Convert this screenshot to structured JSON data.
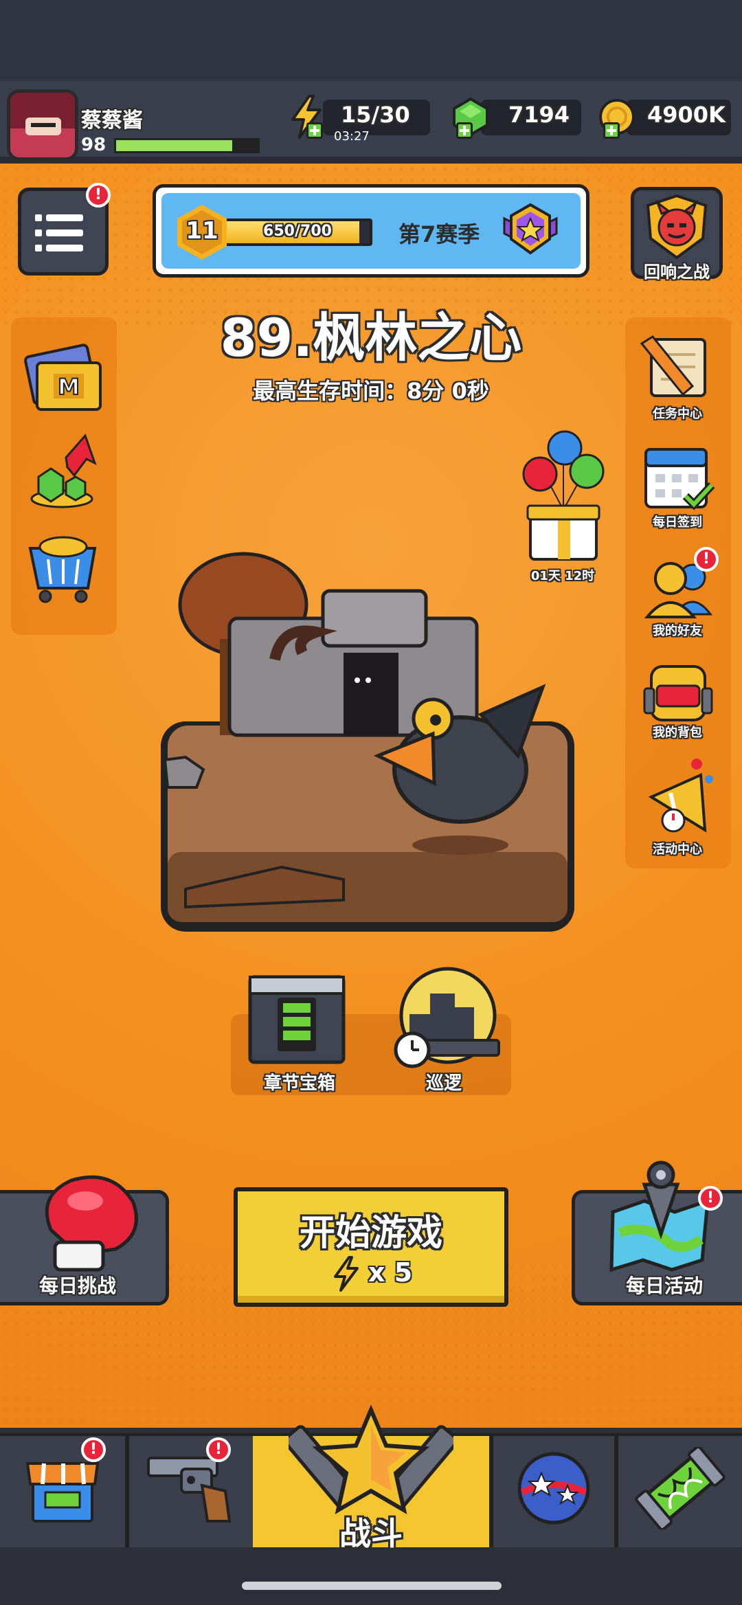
{
  "player": {
    "name": "蔡蔡酱",
    "level": "98",
    "xp_fraction": 0.82
  },
  "resources": {
    "energy": "15/30",
    "energy_timer": "03:27",
    "gems": "7194",
    "coins": "4900K"
  },
  "season": {
    "level": "11",
    "progress_text": "650/700",
    "progress_fraction": 0.9286,
    "name": "第7赛季"
  },
  "echo_battle": {
    "label": "回响之战"
  },
  "stage": {
    "title": "89.枫林之心",
    "best_time": "最高生存时间：8分 0秒"
  },
  "right_menu": {
    "tasks": "任务中心",
    "daily_signin": "每日签到",
    "friends": "我的好友",
    "backpack": "我的背包",
    "events": "活动中心"
  },
  "gift_timer": "01天 12时",
  "chapter": {
    "chest_label": "章节宝箱",
    "patrol_label": "巡逻"
  },
  "actions": {
    "daily_challenge": "每日挑战",
    "start_game": "开始游戏",
    "start_cost": "x 5",
    "daily_event": "每日活动"
  },
  "nav": {
    "battle_label": "战斗"
  },
  "badges": {
    "exclaim": "!"
  },
  "colors": {
    "background": "#f5901c",
    "panel_dark": "#3a3f4e",
    "button_yellow": "#f3cf37",
    "badge_red": "#e8243a",
    "season_blue": "#5fb8f2"
  },
  "icons": [
    "avatar",
    "lightning-icon",
    "gem-icon",
    "coin-icon",
    "menu-icon",
    "season-emblem-icon",
    "demon-icon",
    "map-card-icon",
    "gem-upgrade-icon",
    "shopping-cart-icon",
    "scroll-pencil-icon",
    "calendar-icon",
    "friends-icon",
    "backpack-icon",
    "party-horn-icon",
    "balloon-gift-icon",
    "chest-icon",
    "patrol-icon",
    "boxing-glove-icon",
    "map-pin-icon",
    "shop-icon",
    "revolver-icon",
    "battle-star-icon",
    "planet-icon",
    "dna-capsule-icon"
  ]
}
